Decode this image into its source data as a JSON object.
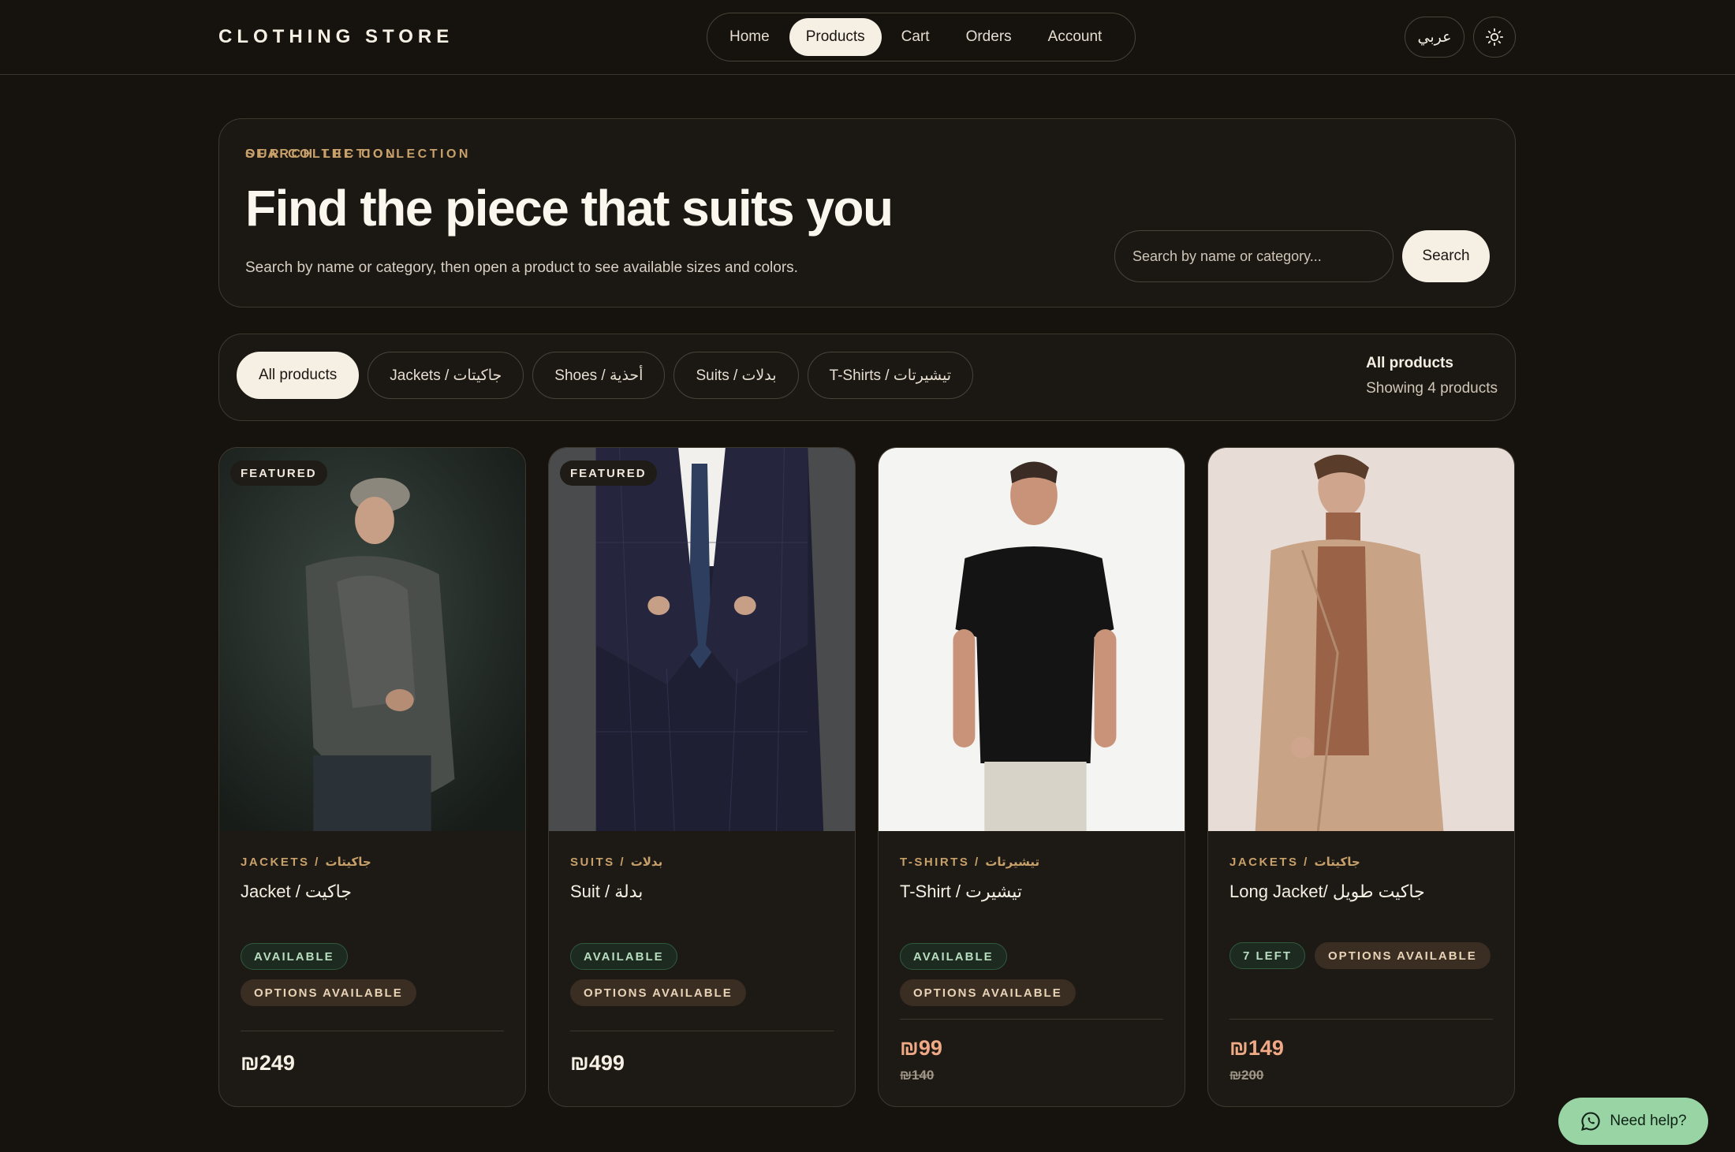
{
  "header": {
    "brand": "CLOTHING STORE",
    "nav": [
      {
        "label": "Home",
        "active": false
      },
      {
        "label": "Products",
        "active": true
      },
      {
        "label": "Cart",
        "active": false
      },
      {
        "label": "Orders",
        "active": false
      },
      {
        "label": "Account",
        "active": false
      }
    ],
    "language_label": "عربي",
    "theme_icon": "sun-icon"
  },
  "hero": {
    "eyebrow": "OUR COLLECTION",
    "title": "Find the piece that suits you",
    "subtitle": "Search by name or category, then open a product to see available sizes and colors.",
    "search_label": "SEARCH THE COLLECTION",
    "search_placeholder": "Search by name or category...",
    "search_value": "",
    "search_button": "Search"
  },
  "filters": {
    "chips": [
      {
        "label": "All products",
        "active": true
      },
      {
        "label": "Jackets / جاكيتات",
        "active": false
      },
      {
        "label": "Shoes / أحذية",
        "active": false
      },
      {
        "label": "Suits / بدلات",
        "active": false
      },
      {
        "label": "T-Shirts / تيشيرتات",
        "active": false
      }
    ],
    "status_title": "All products",
    "status_count": "Showing 4 products"
  },
  "products": [
    {
      "featured_label": "FEATURED",
      "category": "JACKETS / جاكيتات",
      "name": "Jacket / جاكيت",
      "tags": [
        "AVAILABLE",
        "OPTIONS AVAILABLE"
      ],
      "price": "₪249",
      "old_price": ""
    },
    {
      "featured_label": "FEATURED",
      "category": "SUITS / بدلات",
      "name": "Suit / بدلة",
      "tags": [
        "AVAILABLE",
        "OPTIONS AVAILABLE"
      ],
      "price": "₪499",
      "old_price": ""
    },
    {
      "featured_label": "",
      "category": "T-SHIRTS / تيشيرتات",
      "name": "T-Shirt / تيشيرت",
      "tags": [
        "AVAILABLE",
        "OPTIONS AVAILABLE"
      ],
      "price": "₪99",
      "old_price": "₪140"
    },
    {
      "featured_label": "",
      "category": "JACKETS / جاكيتات",
      "name": "Long Jacket/ جاكيت طويل",
      "tags": [
        "7 LEFT",
        "OPTIONS AVAILABLE"
      ],
      "price": "₪149",
      "old_price": "₪200"
    }
  ],
  "help": {
    "label": "Need help?",
    "icon": "whatsapp-icon"
  },
  "colors": {
    "background": "#16130f",
    "accent": "#c8a06a",
    "sale_price": "#f0a985",
    "help_button": "#98d4a4"
  }
}
